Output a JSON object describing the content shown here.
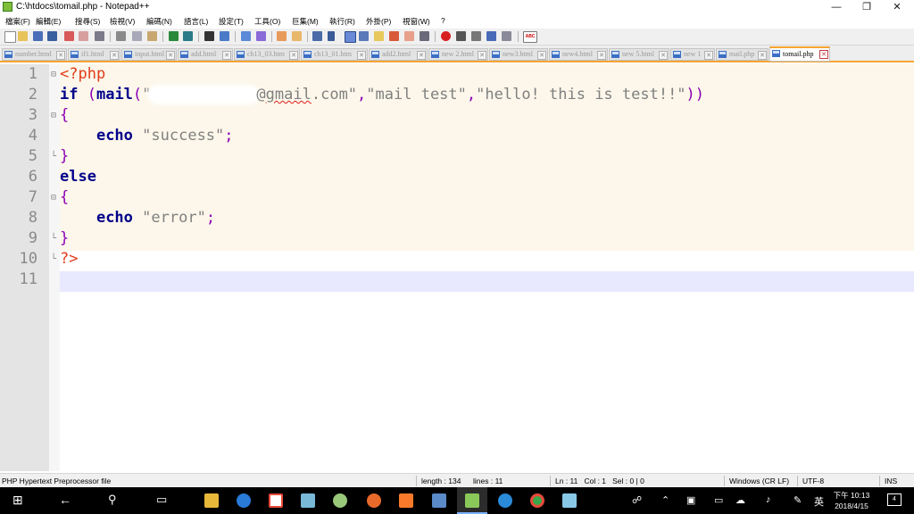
{
  "window": {
    "title": "C:\\htdocs\\tomail.php - Notepad++",
    "minimize": "—",
    "restore": "❐",
    "close": "✕"
  },
  "menu": [
    "檔案(F)",
    "編輯(E)",
    "搜尋(S)",
    "檢視(V)",
    "編碼(N)",
    "語言(L)",
    "設定(T)",
    "工具(O)",
    "巨集(M)",
    "執行(R)",
    "外掛(P)",
    "視窗(W)",
    "?"
  ],
  "toolbar": {
    "icons": [
      "new-file-icon",
      "open-file-icon",
      "save-icon",
      "save-all-icon",
      "close-icon",
      "close-all-icon",
      "print-icon",
      "cut-icon",
      "copy-icon",
      "paste-icon",
      "undo-icon",
      "redo-icon",
      "find-icon",
      "replace-icon",
      "zoom-in-icon",
      "zoom-out-icon",
      "sync-vertical-icon",
      "sync-horizontal-icon",
      "word-wrap-icon",
      "show-all-chars-icon",
      "indent-guide-icon",
      "user-lang-icon",
      "doc-map-icon",
      "function-list-icon",
      "folder-workspace-icon",
      "monitor-icon",
      "record-macro-icon",
      "stop-macro-icon",
      "play-macro-icon",
      "run-macro-multiple-icon",
      "save-macro-icon",
      "spell-check-icon"
    ],
    "spell_label": "ABC"
  },
  "tabs": [
    {
      "label": "number.html",
      "active": false
    },
    {
      "label": "if1.html",
      "active": false
    },
    {
      "label": "input.html",
      "active": false
    },
    {
      "label": "add.html",
      "active": false
    },
    {
      "label": "ch13_03.htm",
      "active": false
    },
    {
      "label": "ch13_01.htm",
      "active": false
    },
    {
      "label": "add2.html",
      "active": false
    },
    {
      "label": "new 2.html",
      "active": false
    },
    {
      "label": "new3.html",
      "active": false
    },
    {
      "label": "new4.html",
      "active": false
    },
    {
      "label": "new 5.html",
      "active": false
    },
    {
      "label": "new 1",
      "active": false
    },
    {
      "label": "mail.php",
      "active": false
    },
    {
      "label": "tomail.php",
      "active": true
    }
  ],
  "editor": {
    "line_numbers": [
      "1",
      "2",
      "3",
      "4",
      "5",
      "6",
      "7",
      "8",
      "9",
      "10",
      "11"
    ],
    "code": {
      "l1_open": "<?php",
      "l2_if": "if",
      "l2_paren_open": " (",
      "l2_mail": "mail",
      "l2_paren_open2": "(",
      "l2_str1_start": "\"",
      "l2_gmail": "gmail",
      "l2_str1_at": "@",
      "l2_str1_end": ".com\"",
      "l2_comma1": ",",
      "l2_str2": "\"mail test\"",
      "l2_comma2": ",",
      "l2_str3": "\"hello! this is test!!\"",
      "l2_close": "))",
      "l3_brace": "{",
      "l4_echo": "echo",
      "l4_str": "\"success\"",
      "l4_semi": ";",
      "l5_brace": "}",
      "l6_else": "else",
      "l7_brace": "{",
      "l8_echo": "echo",
      "l8_str": "\"error\"",
      "l8_semi": ";",
      "l9_brace": "}",
      "l10_close": "?>"
    }
  },
  "status": {
    "file_type": "PHP Hypertext Preprocessor file",
    "length": "length : 134",
    "lines": "lines : 11",
    "position": "Ln : 11   Col : 1   Sel : 0 | 0",
    "eol": "Windows (CR LF)",
    "encoding": "UTF-8",
    "mode": "INS"
  },
  "taskbar": {
    "apps": [
      "file-explorer-icon",
      "chrome-like-icon",
      "google-icon",
      "notepad-icon",
      "tool-icon",
      "firefox-icon",
      "xampp-icon",
      "virtualbox-icon",
      "notepadpp-icon",
      "edge-icon",
      "chrome-icon",
      "notes-icon"
    ],
    "tray_lang": "英",
    "time": "下午 10:13",
    "date": "2018/4/15",
    "notifications": "4"
  }
}
